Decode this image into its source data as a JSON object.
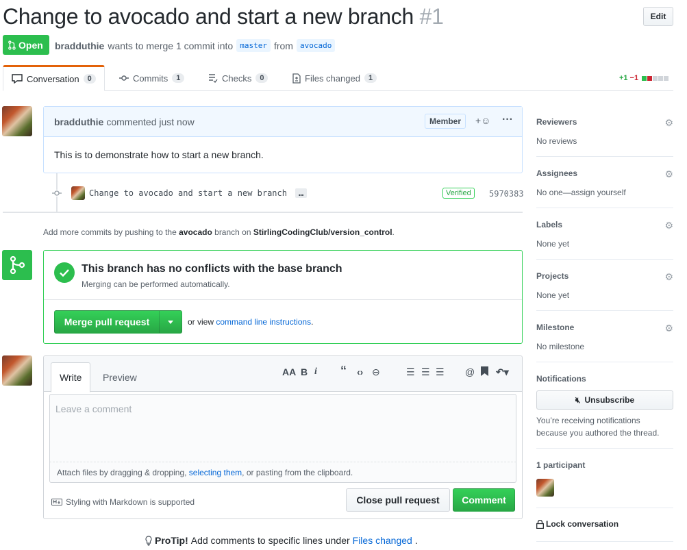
{
  "header": {
    "title": "Change to avocado and start a new branch",
    "number": "#1",
    "edit_label": "Edit",
    "status": "Open",
    "author": "bradduthie",
    "merge_text": "wants to merge 1 commit into",
    "base_branch": "master",
    "from_text": "from",
    "head_branch": "avocado"
  },
  "tabs": [
    {
      "label": "Conversation",
      "count": "0"
    },
    {
      "label": "Commits",
      "count": "1"
    },
    {
      "label": "Checks",
      "count": "0"
    },
    {
      "label": "Files changed",
      "count": "1"
    }
  ],
  "diffstat": {
    "additions": "+1",
    "deletions": "−1"
  },
  "comment": {
    "author": "bradduthie",
    "action": "commented just now",
    "badge": "Member",
    "body": "This is to demonstrate how to start a new branch."
  },
  "commit": {
    "message": "Change to avocado and start a new branch",
    "ellipsis": "…",
    "verified": "Verified",
    "sha": "5970383"
  },
  "push_note": {
    "prefix": "Add more commits by pushing to the",
    "branch": "avocado",
    "middle": "branch on",
    "repo": "StirlingCodingClub/version_control",
    "suffix": "."
  },
  "merge": {
    "title": "This branch has no conflicts with the base branch",
    "subtitle": "Merging can be performed automatically.",
    "button": "Merge pull request",
    "alt_prefix": "or view",
    "alt_link": "command line instructions",
    "alt_suffix": "."
  },
  "editor": {
    "write_tab": "Write",
    "preview_tab": "Preview",
    "placeholder": "Leave a comment",
    "attach_prefix": "Attach files by dragging & dropping,",
    "attach_link": "selecting them",
    "attach_suffix": ", or pasting from the clipboard.",
    "markdown_note": "Styling with Markdown is supported",
    "close_button": "Close pull request",
    "comment_button": "Comment"
  },
  "protip": {
    "label": "ProTip!",
    "text": "Add comments to specific lines under",
    "link": "Files changed",
    "suffix": "."
  },
  "sidebar": {
    "reviewers": {
      "heading": "Reviewers",
      "value": "No reviews"
    },
    "assignees": {
      "heading": "Assignees",
      "value": "No one—assign yourself"
    },
    "labels": {
      "heading": "Labels",
      "value": "None yet"
    },
    "projects": {
      "heading": "Projects",
      "value": "None yet"
    },
    "milestone": {
      "heading": "Milestone",
      "value": "No milestone"
    },
    "notifications": {
      "heading": "Notifications",
      "button": "Unsubscribe",
      "note": "You’re receiving notifications because you authored the thread."
    },
    "participants": {
      "heading": "1 participant"
    },
    "lock": "Lock conversation"
  },
  "colors": {
    "accent_green": "#2cbe4e",
    "link_blue": "#0366d6",
    "tab_orange": "#e36209"
  }
}
